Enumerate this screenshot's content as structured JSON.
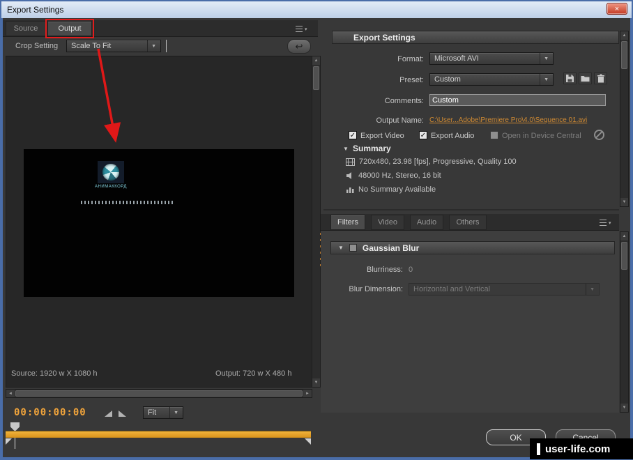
{
  "window": {
    "title": "Export Settings"
  },
  "icons": {
    "close": "×",
    "dropdown_arrow": "▼",
    "scroll_up": "▲",
    "scroll_down": "▼",
    "scroll_left": "◄",
    "scroll_right": "►",
    "panel_menu_arrow": "▾",
    "undo_arrow": "↩",
    "check": "✓",
    "disclosure_down": "▼"
  },
  "left": {
    "tabs": {
      "source": "Source",
      "output": "Output"
    },
    "crop_setting_label": "Crop Setting",
    "crop_value": "Scale To Fit",
    "preview": {
      "caption": "АНИМАККОРД"
    },
    "source_info": "Source: 1920 w X 1080 h",
    "output_info": "Output: 720 w X 480 h",
    "timecode": "00:00:00:00",
    "fit_value": "Fit"
  },
  "settings": {
    "header": "Export Settings",
    "format": {
      "label": "Format:",
      "value": "Microsoft AVI"
    },
    "preset": {
      "label": "Preset:",
      "value": "Custom"
    },
    "comments": {
      "label": "Comments:",
      "value": "Custom"
    },
    "output_name": {
      "label": "Output Name:",
      "value": "C:\\User...Adobe\\Premiere Pro\\4.0\\Sequence 01.avi"
    },
    "export_video_label": "Export Video",
    "export_audio_label": "Export Audio",
    "open_device_label": "Open in Device Central",
    "summary": {
      "label": "Summary",
      "video": "720x480, 23.98 [fps], Progressive, Quality 100",
      "audio": "48000 Hz, Stereo, 16 bit",
      "other": "No Summary Available"
    }
  },
  "filters": {
    "tabs": {
      "filters": "Filters",
      "video": "Video",
      "audio": "Audio",
      "others": "Others"
    },
    "gaussian_blur_label": "Gaussian Blur",
    "blurriness": {
      "label": "Blurriness:",
      "value": "0"
    },
    "blur_dimension": {
      "label": "Blur Dimension:",
      "value": "Horizontal and Vertical"
    }
  },
  "buttons": {
    "ok": "OK",
    "cancel": "Cancel"
  },
  "watermark": "user-life.com"
}
